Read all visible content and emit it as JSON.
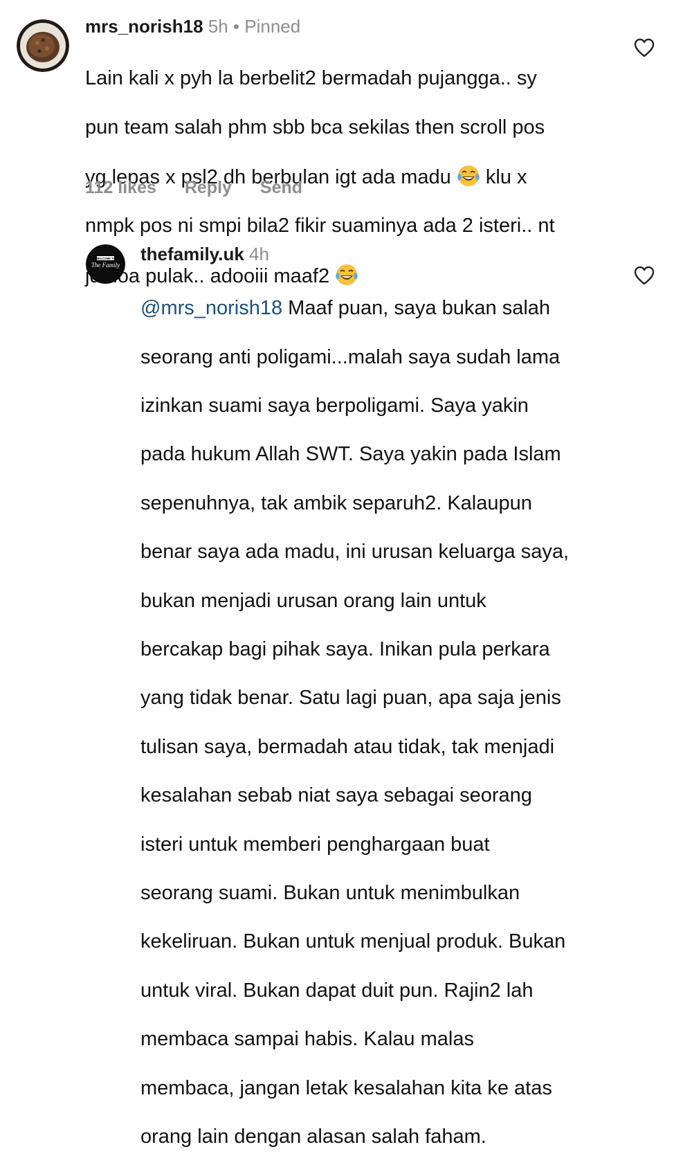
{
  "comments": [
    {
      "username": "mrs_norish18",
      "time": "5h",
      "separator": "•",
      "pinned_label": "Pinned",
      "avatar_icon": "cake-avatar-icon",
      "text_lines": [
        "Lain kali x pyh la berbelit2 bermadah pujangga.. sy",
        "pun team salah phm sbb bca sekilas then scroll pos",
        "yg lepas x psl2 dh berbulan igt ada madu",
        "nmpk pos ni smpi bila2 fikir suaminya ada 2 isteri.. nt",
        "jd doa pulak.. adooiii maaf2"
      ],
      "line3_after_emoji": " klu x",
      "emoji": "face-with-tears-of-joy-icon",
      "likes": "112 likes",
      "reply_label": "Reply",
      "send_label": "Send"
    },
    {
      "username": "thefamily.uk",
      "time": "4h",
      "avatar_icon": "the-family-logo-icon",
      "avatar_text_top": "WELCOME TO",
      "avatar_text_main": "The Family",
      "mention": "@mrs_norish18",
      "text_first_line_rest": " Maaf puan, saya bukan salah",
      "text_lines": [
        "seorang anti poligami...malah saya sudah lama",
        "izinkan suami saya berpoligami. Saya yakin",
        "pada hukum Allah SWT. Saya yakin pada Islam",
        "sepenuhnya, tak ambik separuh2. Kalaupun",
        "benar saya ada madu, ini urusan keluarga saya,",
        "bukan menjadi urusan orang lain untuk",
        "bercakap bagi pihak saya. Inikan pula perkara",
        "yang tidak benar. Satu lagi puan, apa saja jenis",
        "tulisan saya, bermadah atau tidak, tak menjadi",
        "kesalahan sebab niat saya sebagai seorang",
        "isteri untuk memberi penghargaan buat",
        "seorang suami. Bukan untuk menimbulkan",
        "kekeliruan. Bukan untuk menjual produk. Bukan",
        "untuk viral. Bukan dapat duit pun. Rajin2 lah",
        "membaca sampai habis. Kalau malas",
        "membaca, jangan letak kesalahan kita ke atas",
        "orang lain dengan alasan salah faham."
      ]
    }
  ],
  "icons": {
    "like": "heart-outline-icon"
  },
  "colors": {
    "text": "#111111",
    "muted": "#8e8e8e",
    "mention": "#1e4f7e"
  }
}
